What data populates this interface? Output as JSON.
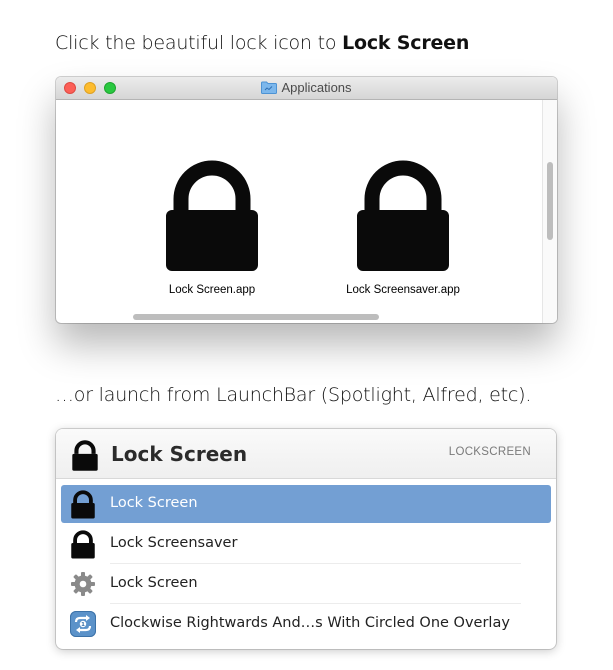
{
  "caption1": {
    "prefix": "Click the beautiful lock icon to ",
    "bold": "Lock Screen"
  },
  "caption2": "…or launch from LaunchBar (Spotlight, Alfred, etc).",
  "finder": {
    "title": "Applications",
    "title_icon": "folder-icon",
    "apps": [
      {
        "label": "Lock Screen.app",
        "icon": "lock-icon"
      },
      {
        "label": "Lock Screensaver.app",
        "icon": "lock-icon"
      }
    ]
  },
  "launchbar": {
    "title": "Lock Screen",
    "abbreviation": "LOCKSCREEN",
    "items": [
      {
        "label": "Lock Screen",
        "icon": "lock-icon",
        "selected": true
      },
      {
        "label": "Lock Screensaver",
        "icon": "lock-icon",
        "selected": false
      },
      {
        "label": "Lock Screen",
        "icon": "gear-icon",
        "selected": false
      },
      {
        "label": "Clockwise Rightwards And…s With Circled One Overlay",
        "icon": "repeat-once-icon",
        "selected": false
      }
    ],
    "selection_color": "#739fd3"
  }
}
